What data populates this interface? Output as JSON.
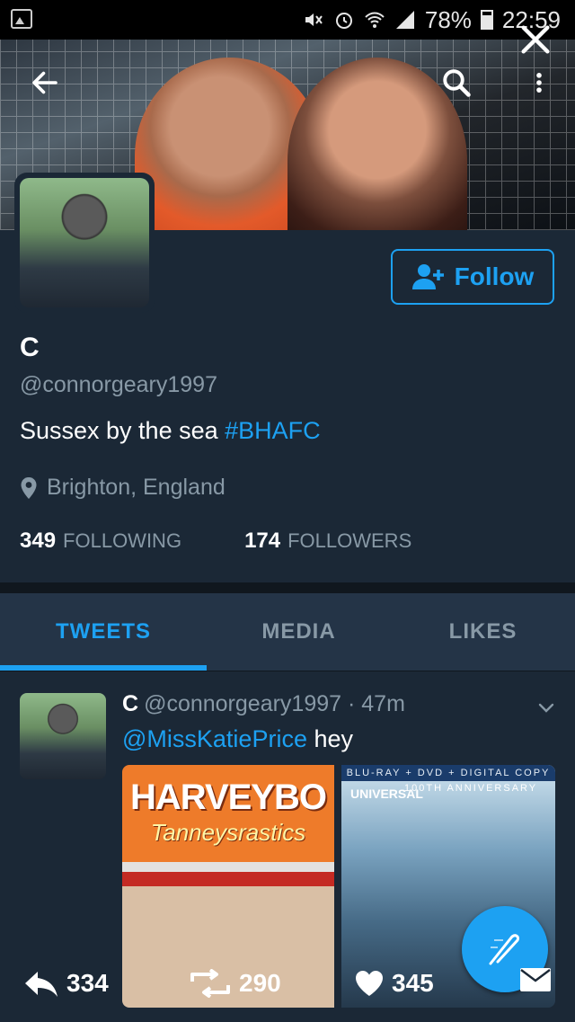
{
  "status_bar": {
    "battery": "78%",
    "time": "22:59"
  },
  "header": {
    "icons": [
      "back-arrow-icon",
      "search-icon",
      "more-vertical-icon",
      "close-icon"
    ]
  },
  "profile": {
    "name": "C",
    "handle": "@connorgeary1997",
    "bio_text": "Sussex by the sea ",
    "bio_hashtag": "#BHAFC",
    "location": "Brighton, England",
    "following_count": "349",
    "following_label": "FOLLOWING",
    "followers_count": "174",
    "followers_label": "FOLLOWERS",
    "follow_label": "Follow"
  },
  "tabs": [
    {
      "label": "TWEETS",
      "active": true
    },
    {
      "label": "MEDIA",
      "active": false
    },
    {
      "label": "LIKES",
      "active": false
    }
  ],
  "tweet": {
    "name": "C",
    "handle": "@connorgeary1997",
    "time": "· 47m",
    "mention": "@MissKatiePrice",
    "text": " hey",
    "media_left_title": "HARVEYBO",
    "media_left_sub": "Tanneysrastics",
    "media_right_band": "BLU-RAY + DVD + DIGITAL COPY",
    "media_right_brand": "UNIVERSAL",
    "media_right_anniv": "100TH ANNIVERSARY",
    "reply_count": "334",
    "retweet_count": "290",
    "like_count": "345"
  },
  "colors": {
    "accent": "#1da1f2",
    "background": "#1b2836",
    "tabs_bg": "#243447",
    "muted": "#8899a6"
  }
}
